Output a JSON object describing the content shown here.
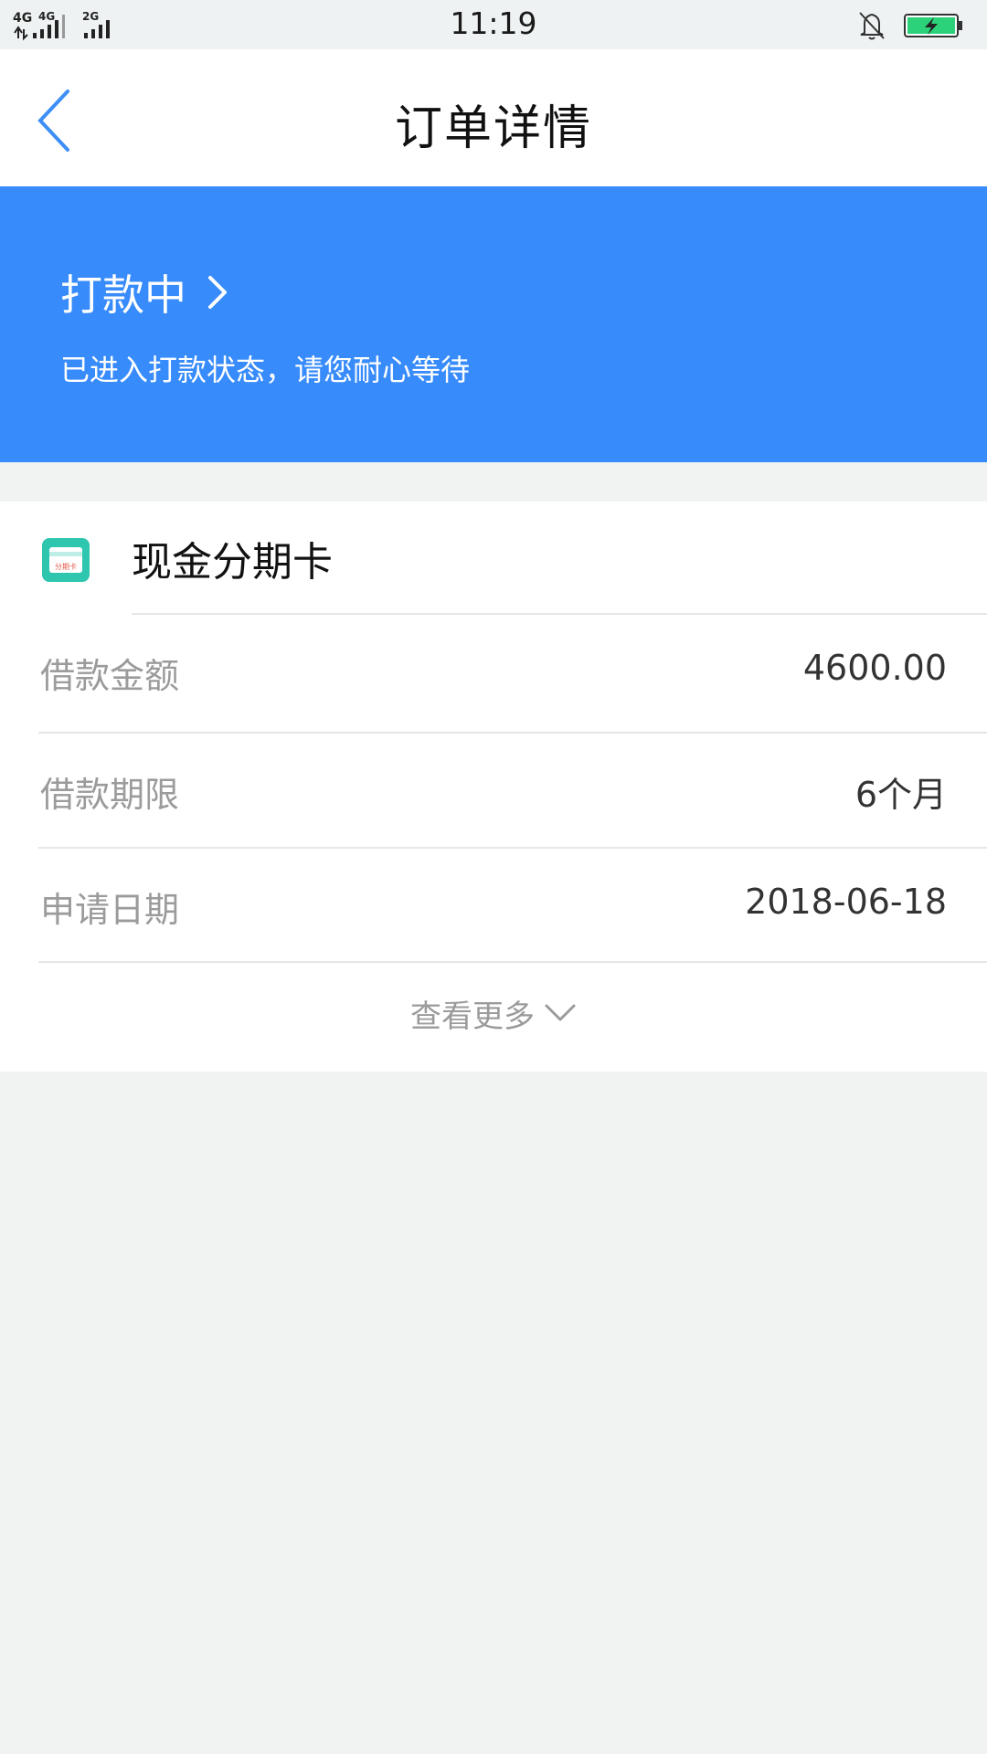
{
  "status_bar": {
    "time": "11:19",
    "network_1": "4G",
    "network_2": "4G",
    "network_3": "2G"
  },
  "nav": {
    "title": "订单详情"
  },
  "banner": {
    "title": "打款中",
    "subtitle": "已进入打款状态，请您耐心等待",
    "background": "#378bfb"
  },
  "product": {
    "name": "现金分期卡",
    "icon_text": "分期卡"
  },
  "details": [
    {
      "label": "借款金额",
      "value": "4600.00"
    },
    {
      "label": "借款期限",
      "value": "6个月"
    },
    {
      "label": "申请日期",
      "value": "2018-06-18"
    }
  ],
  "more": {
    "label": "查看更多"
  },
  "colors": {
    "accent": "#378bfb",
    "back_icon": "#3d8ef6",
    "battery_fill": "#2bd27a",
    "product_icon": "#2fc6b0"
  }
}
